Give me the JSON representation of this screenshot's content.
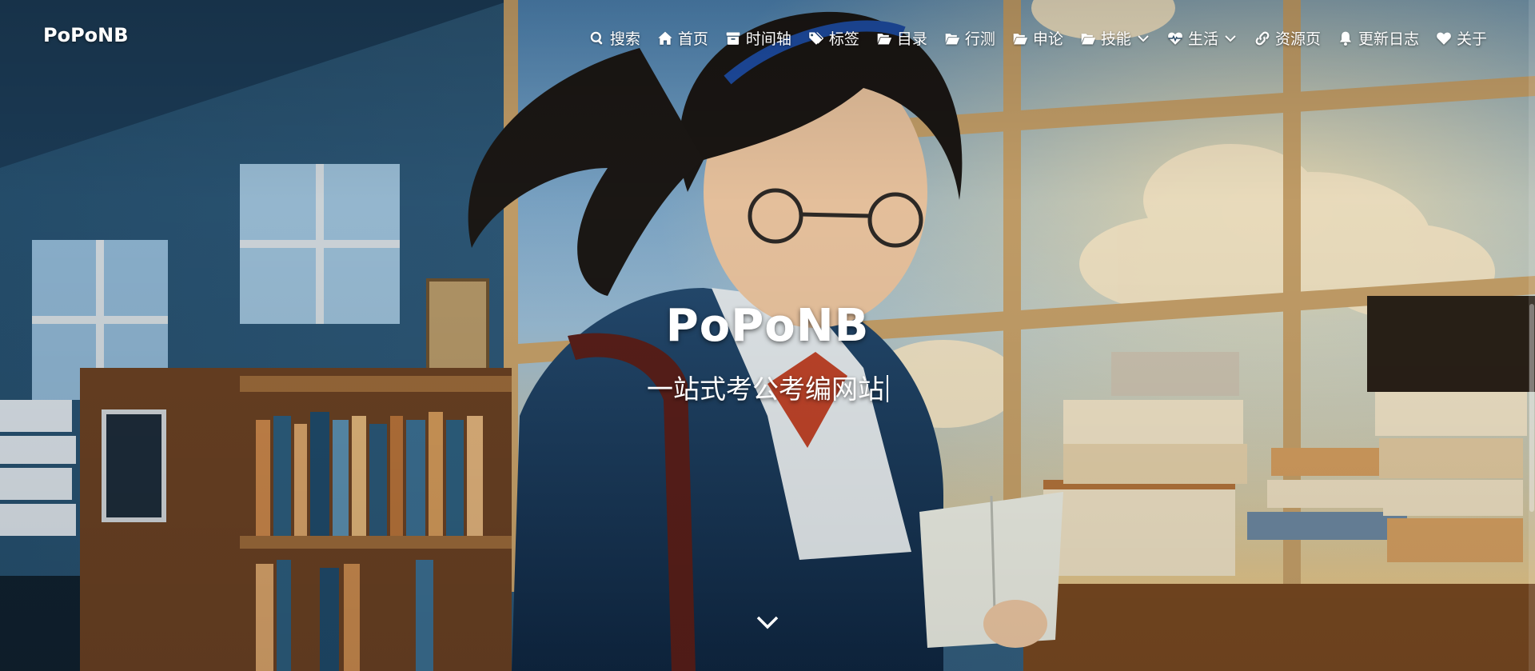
{
  "site": {
    "brand": "PoPoNB",
    "title": "PoPoNB",
    "subtitle": "一站式考公考编网站"
  },
  "nav": {
    "items": [
      {
        "label": "搜索",
        "icon": "search-icon"
      },
      {
        "label": "首页",
        "icon": "home-icon"
      },
      {
        "label": "时间轴",
        "icon": "archive-icon"
      },
      {
        "label": "标签",
        "icon": "tags-icon"
      },
      {
        "label": "目录",
        "icon": "folder-icon"
      },
      {
        "label": "行测",
        "icon": "folder-icon"
      },
      {
        "label": "申论",
        "icon": "folder-icon"
      },
      {
        "label": "技能",
        "icon": "folder-icon",
        "dropdown": true
      },
      {
        "label": "生活",
        "icon": "heartbeat-icon",
        "dropdown": true
      },
      {
        "label": "资源页",
        "icon": "link-icon"
      },
      {
        "label": "更新日志",
        "icon": "bell-icon"
      },
      {
        "label": "关于",
        "icon": "heart-icon"
      }
    ]
  },
  "hero": {
    "background": "anime illustration of a girl with glasses holding an open book in a library by a sunny window",
    "scroll_icon": "chevron-down-icon"
  },
  "colors": {
    "text": "#ffffff",
    "sky": "#6f9cc4",
    "wood": "#8a5a2c"
  }
}
